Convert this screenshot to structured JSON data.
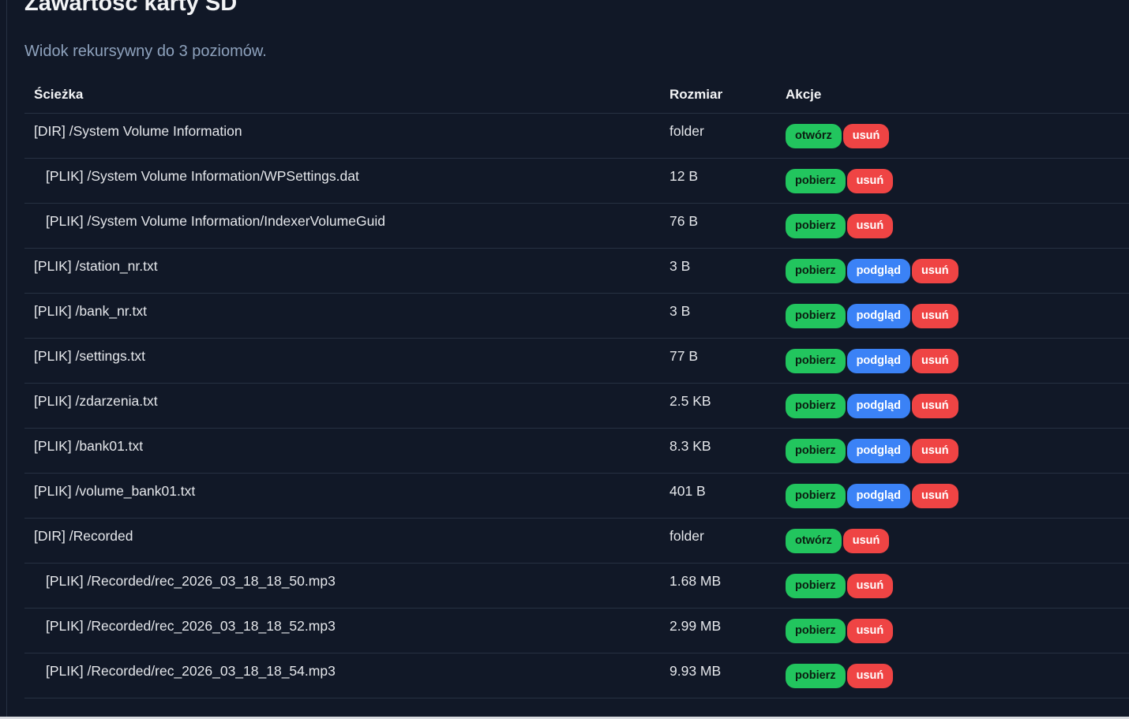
{
  "title": "Zawartość karty SD",
  "subtitle": "Widok rekursywny do 3 poziomów.",
  "columns": {
    "path": "Ścieżka",
    "size": "Rozmiar",
    "actions": "Akcje"
  },
  "labels": {
    "open": "otwórz",
    "download": "pobierz",
    "preview": "podgląd",
    "delete": "usuń"
  },
  "rows": [
    {
      "path": "[DIR] /System Volume Information",
      "size": "folder",
      "indent": false,
      "actions": [
        "open",
        "delete"
      ]
    },
    {
      "path": "[PLIK] /System Volume Information/WPSettings.dat",
      "size": "12 B",
      "indent": true,
      "actions": [
        "download",
        "delete"
      ]
    },
    {
      "path": "[PLIK] /System Volume Information/IndexerVolumeGuid",
      "size": "76 B",
      "indent": true,
      "actions": [
        "download",
        "delete"
      ]
    },
    {
      "path": "[PLIK] /station_nr.txt",
      "size": "3 B",
      "indent": false,
      "actions": [
        "download",
        "preview",
        "delete"
      ]
    },
    {
      "path": "[PLIK] /bank_nr.txt",
      "size": "3 B",
      "indent": false,
      "actions": [
        "download",
        "preview",
        "delete"
      ]
    },
    {
      "path": "[PLIK] /settings.txt",
      "size": "77 B",
      "indent": false,
      "actions": [
        "download",
        "preview",
        "delete"
      ]
    },
    {
      "path": "[PLIK] /zdarzenia.txt",
      "size": "2.5 KB",
      "indent": false,
      "actions": [
        "download",
        "preview",
        "delete"
      ]
    },
    {
      "path": "[PLIK] /bank01.txt",
      "size": "8.3 KB",
      "indent": false,
      "actions": [
        "download",
        "preview",
        "delete"
      ]
    },
    {
      "path": "[PLIK] /volume_bank01.txt",
      "size": "401 B",
      "indent": false,
      "actions": [
        "download",
        "preview",
        "delete"
      ]
    },
    {
      "path": "[DIR] /Recorded",
      "size": "folder",
      "indent": false,
      "actions": [
        "open",
        "delete"
      ]
    },
    {
      "path": "[PLIK] /Recorded/rec_2026_03_18_18_50.mp3",
      "size": "1.68 MB",
      "indent": true,
      "actions": [
        "download",
        "delete"
      ]
    },
    {
      "path": "[PLIK] /Recorded/rec_2026_03_18_18_52.mp3",
      "size": "2.99 MB",
      "indent": true,
      "actions": [
        "download",
        "delete"
      ]
    },
    {
      "path": "[PLIK] /Recorded/rec_2026_03_18_18_54.mp3",
      "size": "9.93 MB",
      "indent": true,
      "actions": [
        "download",
        "delete"
      ]
    }
  ],
  "colors": {
    "green": "#22c55e",
    "blue": "#3b82f6",
    "red": "#ef4444",
    "bg": "#111827"
  }
}
